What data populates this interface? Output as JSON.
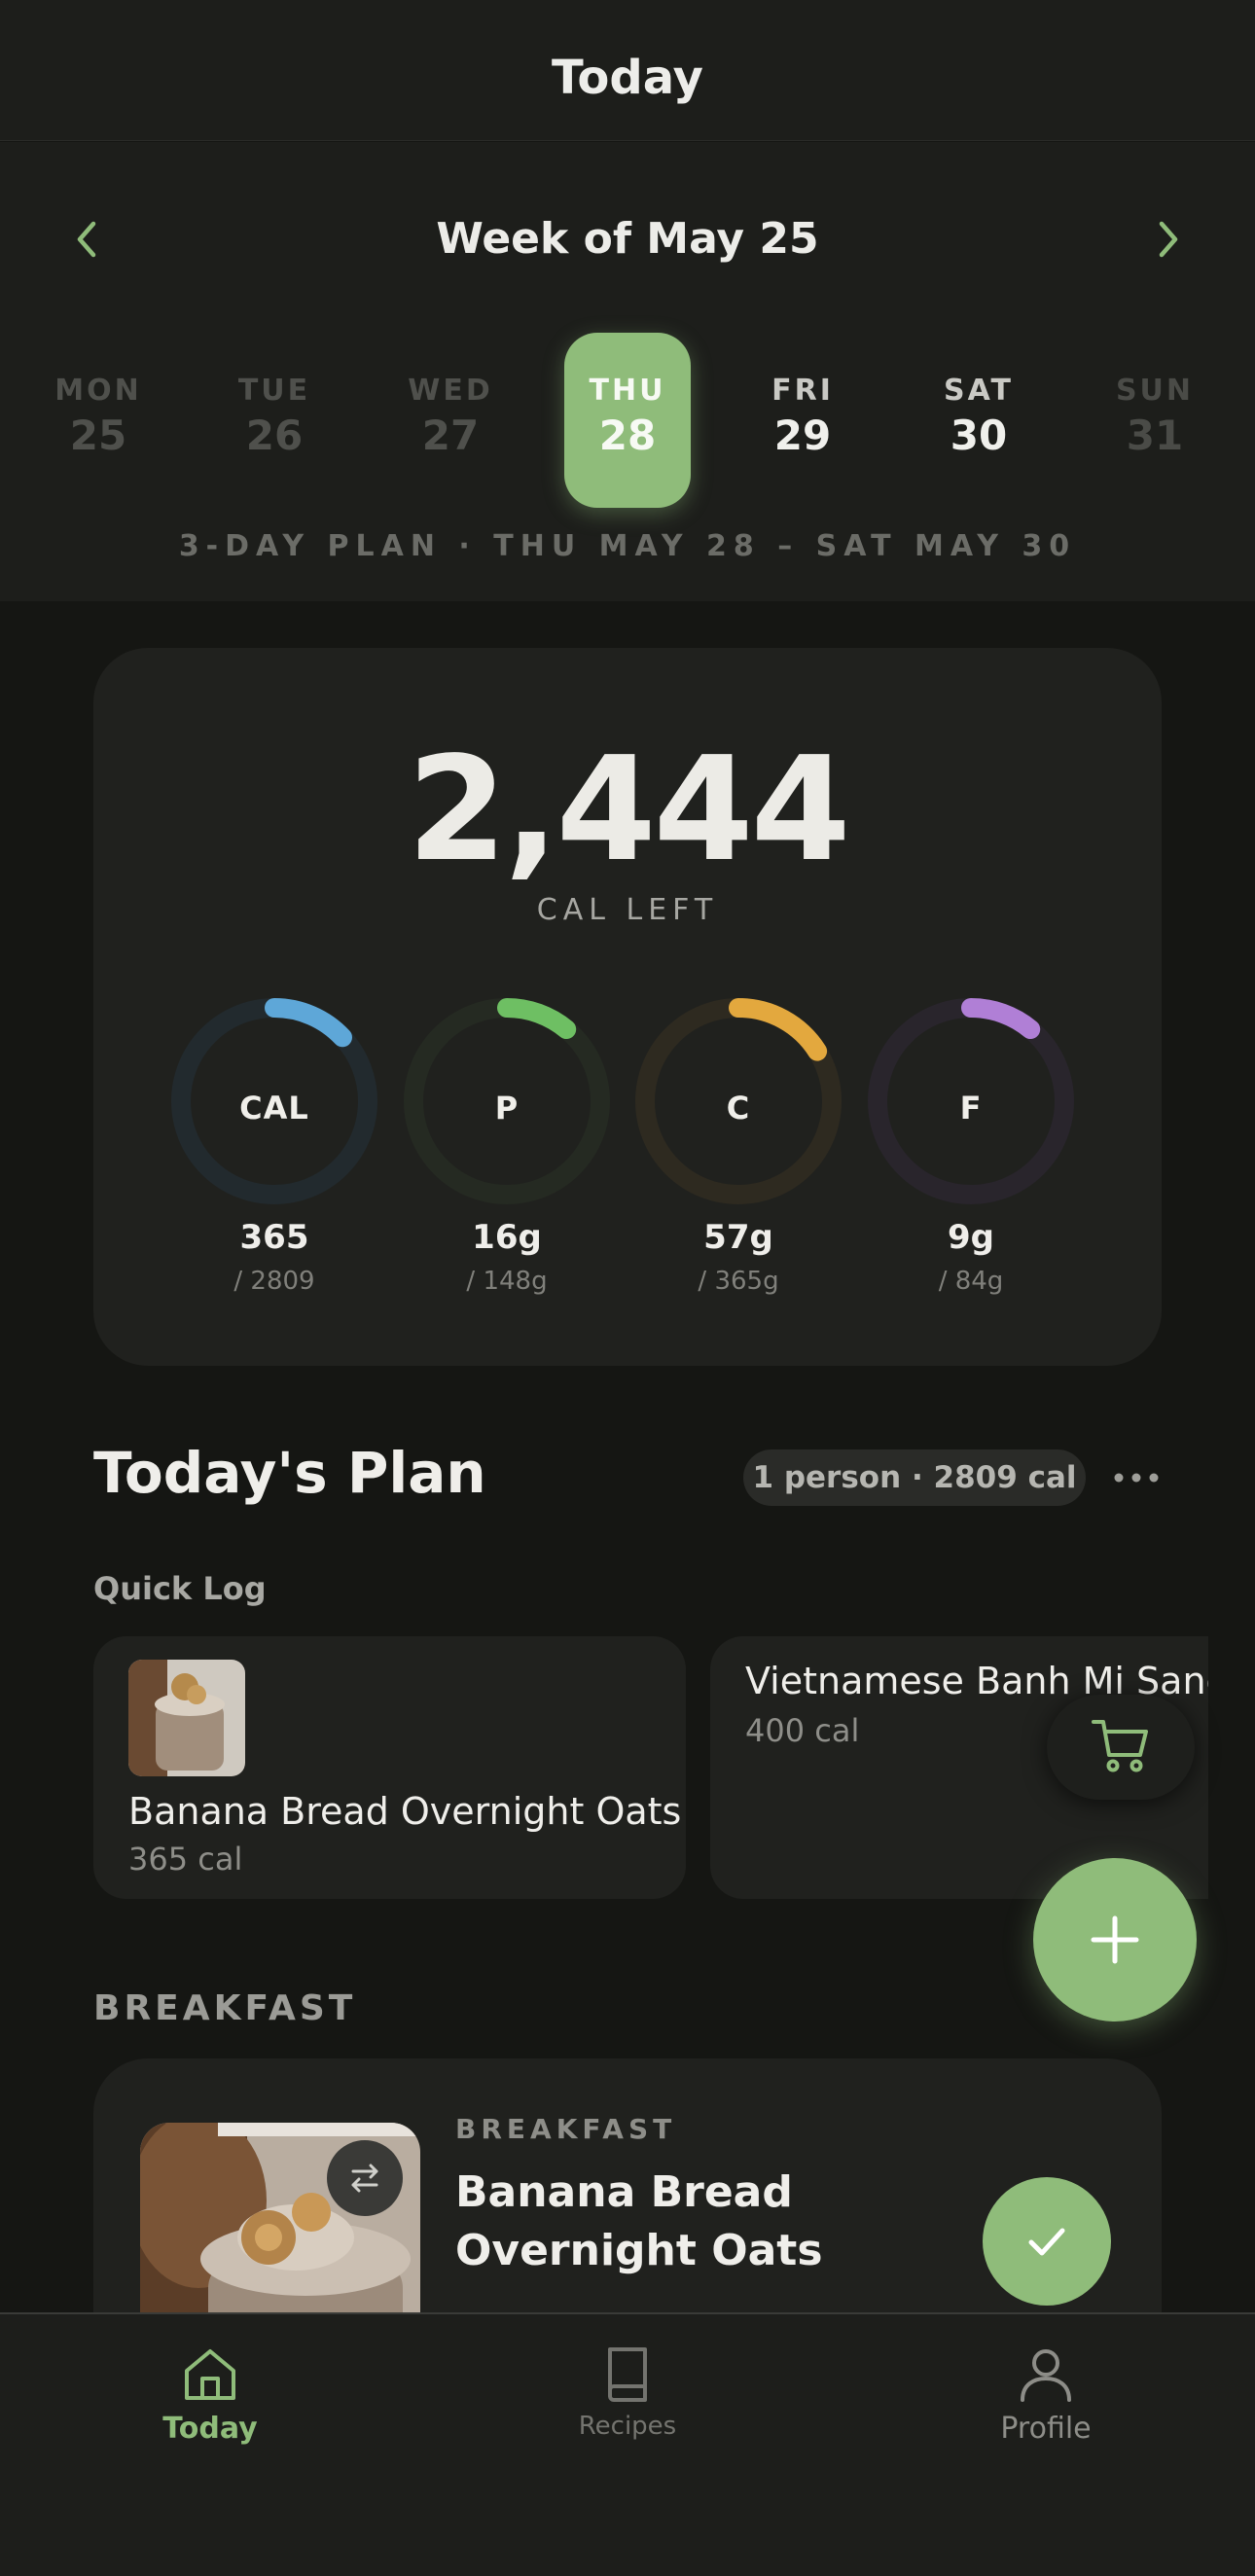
{
  "header": {
    "title": "Today"
  },
  "week": {
    "title": "Week of May 25",
    "prev_icon": "chevron-left-icon",
    "next_icon": "chevron-right-icon",
    "days": [
      {
        "name": "MON",
        "num": "25",
        "state": "past"
      },
      {
        "name": "TUE",
        "num": "26",
        "state": "past"
      },
      {
        "name": "WED",
        "num": "27",
        "state": "past"
      },
      {
        "name": "THU",
        "num": "28",
        "state": "selected"
      },
      {
        "name": "FRI",
        "num": "29",
        "state": "future"
      },
      {
        "name": "SAT",
        "num": "30",
        "state": "future"
      },
      {
        "name": "SUN",
        "num": "31",
        "state": "dim"
      }
    ],
    "plan_range": "3-DAY PLAN · THU MAY 28 – SAT MAY 30"
  },
  "summary": {
    "calories_left": "2,444",
    "calories_left_label": "CAL LEFT",
    "rings": [
      {
        "label": "CAL",
        "value": "365",
        "goal": "/ 2809",
        "fraction": 0.13,
        "color": "#5ea7d8",
        "track": "#222a2e"
      },
      {
        "label": "P",
        "value": "16g",
        "goal": "/ 148g",
        "fraction": 0.11,
        "color": "#6ebf63",
        "track": "#252a22"
      },
      {
        "label": "C",
        "value": "57g",
        "goal": "/ 365g",
        "fraction": 0.16,
        "color": "#e3a83e",
        "track": "#2e2a20"
      },
      {
        "label": "F",
        "value": "9g",
        "goal": "/ 84g",
        "fraction": 0.11,
        "color": "#b07fd6",
        "track": "#29252c"
      }
    ]
  },
  "plan": {
    "title": "Today's Plan",
    "badge": "1 person · 2809 cal",
    "more_icon": "more-horizontal-icon"
  },
  "quick_log": {
    "label": "Quick Log",
    "items": [
      {
        "name": "Banana Bread Overnight Oats",
        "cal": "365 cal"
      },
      {
        "name": "Vietnamese Banh Mi Sandwich",
        "cal": "400 cal"
      }
    ]
  },
  "fabs": {
    "cart_icon": "cart-icon",
    "add_icon": "plus-icon"
  },
  "breakfast": {
    "section_label": "BREAKFAST",
    "meal_type": "BREAKFAST",
    "meal_name": "Banana Bread Overnight Oats",
    "swap_icon": "swap-icon",
    "check_icon": "check-icon"
  },
  "tabs": [
    {
      "label": "Today",
      "icon": "home-icon",
      "active": true
    },
    {
      "label": "Recipes",
      "icon": "book-icon",
      "active": false
    },
    {
      "label": "Profile",
      "icon": "user-icon",
      "active": false
    }
  ],
  "colors": {
    "accent": "#8fbc7a",
    "background": "#151613",
    "surface": "#20211e"
  }
}
